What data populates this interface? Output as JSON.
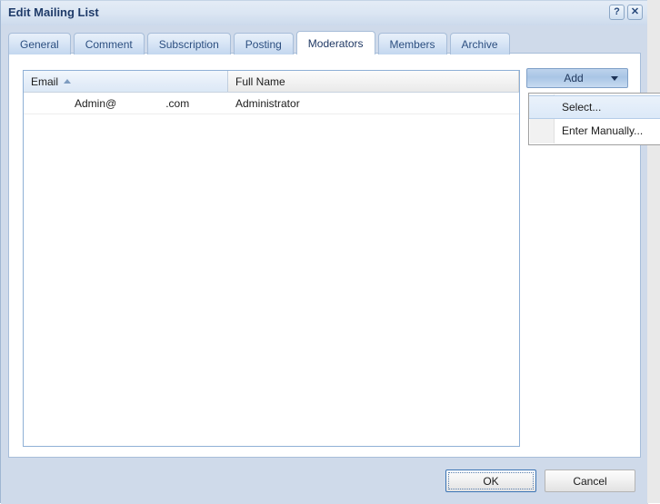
{
  "window": {
    "title": "Edit Mailing List",
    "help_label": "?",
    "close_label": "✕"
  },
  "tabs": [
    {
      "label": "General",
      "active": false
    },
    {
      "label": "Comment",
      "active": false
    },
    {
      "label": "Subscription",
      "active": false
    },
    {
      "label": "Posting",
      "active": false
    },
    {
      "label": "Moderators",
      "active": true
    },
    {
      "label": "Members",
      "active": false
    },
    {
      "label": "Archive",
      "active": false
    }
  ],
  "list": {
    "columns": [
      {
        "key": "email",
        "label": "Email",
        "sorted": true,
        "sort_direction": "asc"
      },
      {
        "key": "name",
        "label": "Full Name",
        "sorted": false,
        "sort_direction": ""
      }
    ],
    "rows": [
      {
        "email_local": "Admin@",
        "email_redacted": "",
        "email_tld": ".com",
        "name": "Administrator"
      }
    ]
  },
  "add_button": {
    "label": "Add",
    "arrow_icon": "chevron-down-icon",
    "expanded": true
  },
  "dropdown": {
    "items": [
      {
        "label": "Select...",
        "highlighted": true
      },
      {
        "label": "Enter Manually...",
        "highlighted": false
      }
    ]
  },
  "footer": {
    "ok_label": "OK",
    "cancel_label": "Cancel"
  },
  "colors": {
    "dialog_chrome": "#cfdaea",
    "title_text": "#1f3b69",
    "tab_text": "#2c4f80",
    "accent_border": "#8fb0d6",
    "ok_focus_border": "#3b74b5"
  }
}
